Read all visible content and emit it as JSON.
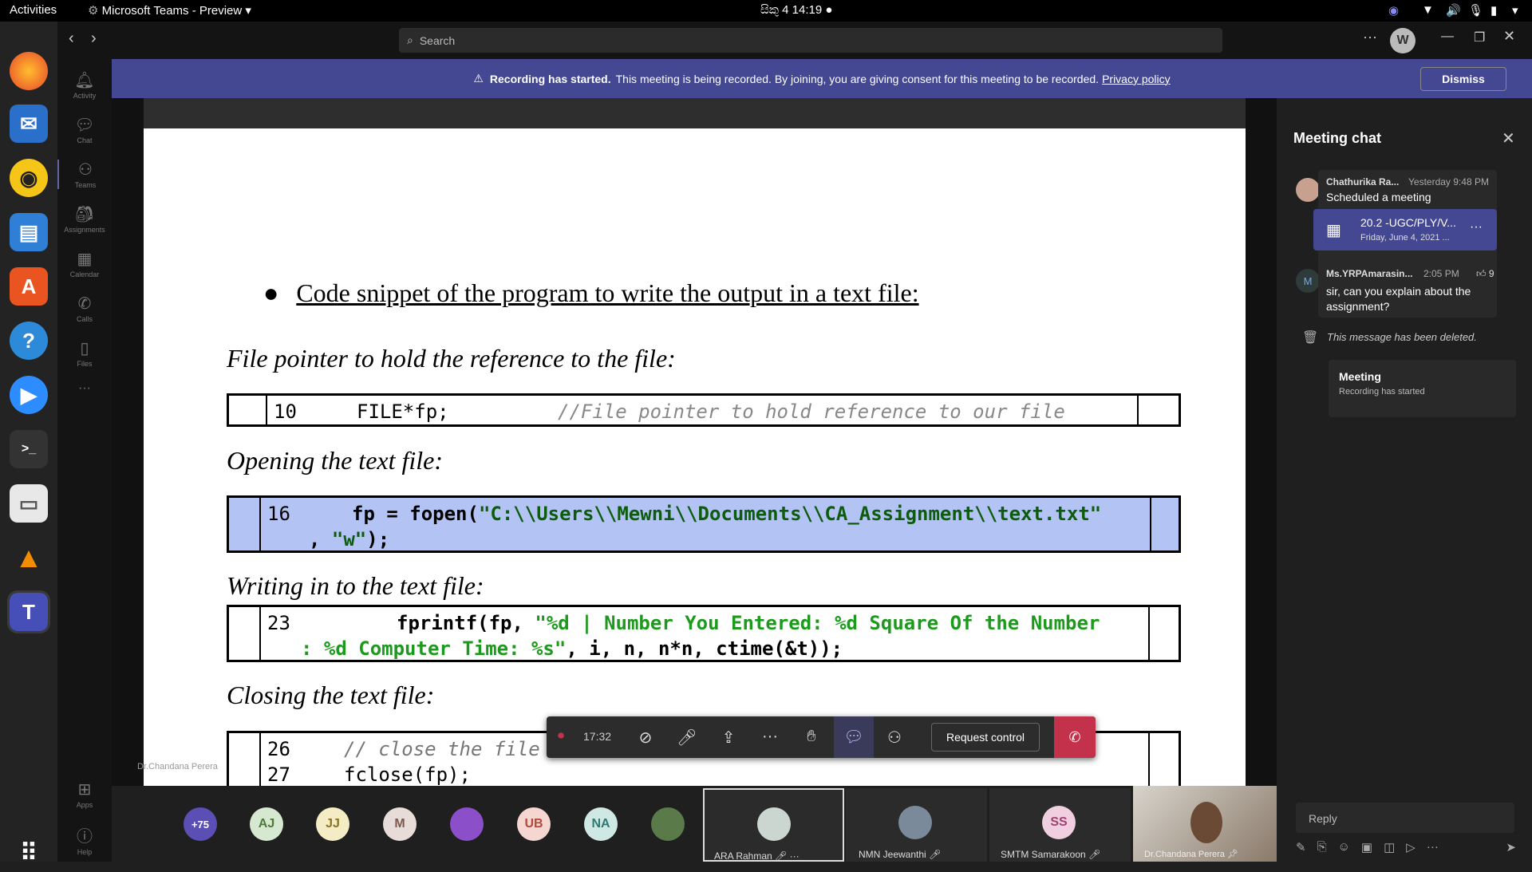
{
  "system": {
    "activities": "Activities",
    "app_menu": "Microsoft Teams - Preview",
    "clock": "4  14:19",
    "clock_prefix": "සිකු"
  },
  "teams": {
    "search_placeholder": "Search",
    "user_initial": "W",
    "rail": [
      "Activity",
      "Chat",
      "Teams",
      "Assignments",
      "Calendar",
      "Calls",
      "Files",
      "Apps",
      "Help"
    ]
  },
  "banner": {
    "title": "Recording has started.",
    "text": "This meeting is being recorded. By joining, you are giving consent for this meeting to be recorded.",
    "link": "Privacy policy",
    "dismiss": "Dismiss"
  },
  "slide": {
    "bullet": "Code snippet of the program to write the output in a text file:",
    "h1": "File pointer to hold the reference to the file:",
    "code1_line": "10",
    "code1_code": "FILE*fp;",
    "code1_comment": "//File pointer to hold reference to our file",
    "h2": "Opening the text file:",
    "code2_line": "16",
    "code2_a": "fp = fopen(",
    "code2_str": "\"C:\\\\Users\\\\Mewni\\\\Documents\\\\CA_Assignment\\\\text.txt\"",
    "code2_b": ", ",
    "code2_w": "\"w\"",
    "code2_c": ");",
    "h3": "Writing in to the text file:",
    "code3_line": "23",
    "code3_a": "fprintf(fp, ",
    "code3_str1": "\"%d | Number You Entered: %d Square Of the Number",
    "code3_str2": ": %d Computer Time: %s\"",
    "code3_b": ", i, n, n*n, ctime(&t));",
    "h4": "Closing the text file:",
    "code4_line1": "26",
    "code4_comment": "// close the file",
    "code4_line2": "27",
    "code4_code": "fclose(fp);",
    "presenter": "Dr.Chandana Perera"
  },
  "chat": {
    "title": "Meeting chat",
    "m1_author": "Chathurika Ra...",
    "m1_time": "Yesterday 9:48 PM",
    "m1_text": "Scheduled a meeting",
    "meeting_title": "20.2 -UGC/PLY/V...",
    "meeting_date": "Friday, June 4, 2021 ...",
    "m2_initial": "M",
    "m2_author": "Ms.YRPAmarasin...",
    "m2_time": "2:05 PM",
    "m2_reactions": "9",
    "m2_text": "sir, can you explain about the assignment?",
    "deleted": "This message has been deleted.",
    "sys_title": "Meeting",
    "sys_text": "Recording has started",
    "reply_placeholder": "Reply"
  },
  "toolbar": {
    "timer": "17:32",
    "request_control": "Request control"
  },
  "participants": {
    "more": "+75",
    "initials": [
      "AJ",
      "JJ",
      "M",
      "UB",
      "NA"
    ],
    "tile1": "ARA Rahman",
    "tile2": "NMN Jeewanthi",
    "tile3_initials": "SS",
    "tile3": "SMTM Samarakoon",
    "tile4": "Dr.Chandana Perera"
  }
}
